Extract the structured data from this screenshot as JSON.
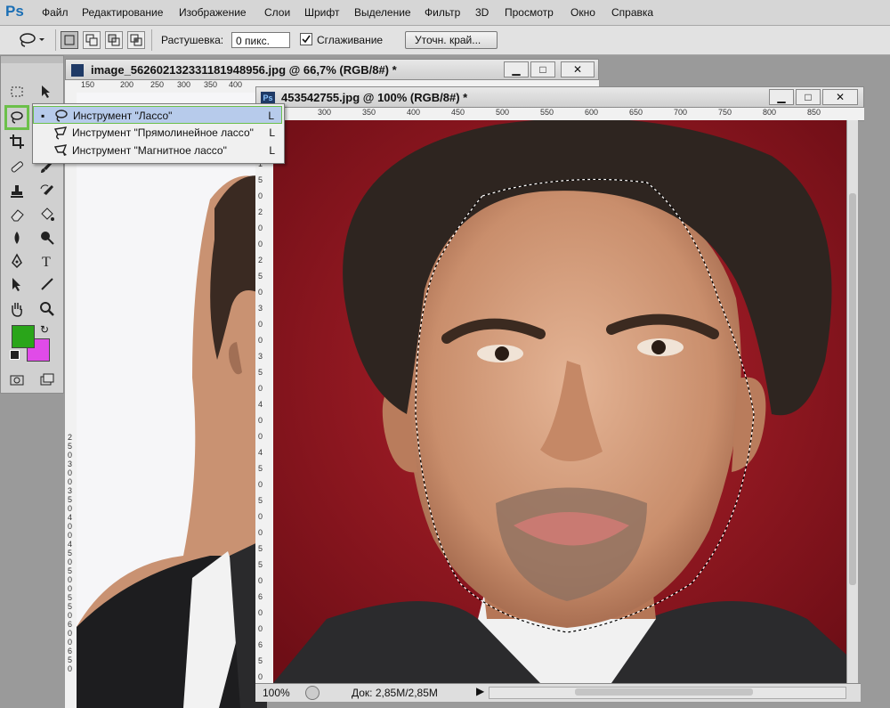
{
  "app": {
    "logo": "Ps"
  },
  "menu": [
    "Файл",
    "Редактирование",
    "Изображение",
    "Слои",
    "Шрифт",
    "Выделение",
    "Фильтр",
    "3D",
    "Просмотр",
    "Окно",
    "Справка"
  ],
  "options": {
    "feather_label": "Растушевка:",
    "feather_value": "0 пикс.",
    "antialias_label": "Сглаживание",
    "antialias_checked": true,
    "refine_edge": "Уточн. край..."
  },
  "doc_back": {
    "title": "image_56260213233118194​8956.jpg @ 66,7% (RGB/8#) *",
    "ruler_top": [
      "150",
      "200",
      "250",
      "300",
      "350",
      "400"
    ],
    "ruler_left": [
      "2",
      "5",
      "0",
      "3",
      "0",
      "0",
      "3",
      "5",
      "0",
      "4",
      "0",
      "0",
      "4",
      "5",
      "0",
      "5",
      "0",
      "0",
      "5",
      "5",
      "0",
      "6",
      "0",
      "0",
      "6",
      "5",
      "0"
    ]
  },
  "doc_front": {
    "title": "453542755.jpg @ 100% (RGB/8#) *",
    "ruler_top": [
      "300",
      "350",
      "400",
      "450",
      "500",
      "550",
      "600",
      "650",
      "700",
      "750",
      "800",
      "850"
    ],
    "ruler_left": [
      "1",
      "5",
      "0",
      "2",
      "0",
      "0",
      "2",
      "5",
      "0",
      "3",
      "0",
      "0",
      "3",
      "5",
      "0",
      "4",
      "0",
      "0",
      "4",
      "5",
      "0",
      "5",
      "0",
      "0",
      "5",
      "5",
      "0",
      "6",
      "0",
      "0",
      "6",
      "5",
      "0"
    ]
  },
  "dropdown": [
    {
      "label": "Инструмент \"Лассо\"",
      "key": "L",
      "selected": true
    },
    {
      "label": "Инструмент \"Прямолинейное лассо\"",
      "key": "L",
      "selected": false
    },
    {
      "label": "Инструмент \"Магнитное лассо\"",
      "key": "L",
      "selected": false
    }
  ],
  "status": {
    "zoom": "100%",
    "doc": "Док: 2,85М/2,85М"
  },
  "colors": {
    "foreground": "#2aa51a",
    "background": "#e04be8",
    "highlight": "#6cc04a",
    "photo_bg": "#8e1620"
  }
}
